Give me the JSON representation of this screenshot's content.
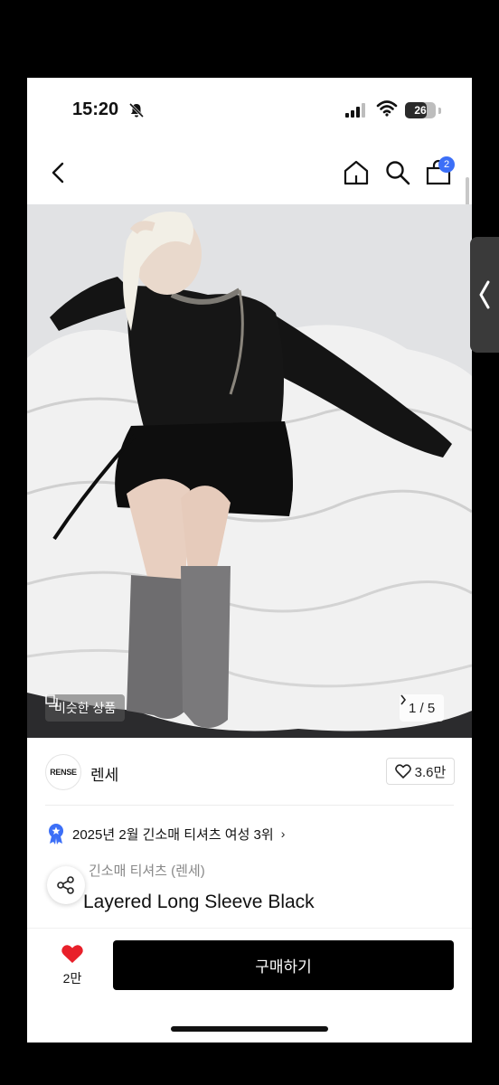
{
  "status_bar": {
    "time": "15:20",
    "battery": "26",
    "icons": [
      "bell-muted-icon",
      "signal-icon",
      "wifi-icon",
      "battery-icon"
    ]
  },
  "header": {
    "icons": [
      "back-arrow-icon",
      "home-icon",
      "search-icon",
      "cart-icon"
    ],
    "cart_badge": "2"
  },
  "hero": {
    "similar_label": "비슷한 상품",
    "page_counter": "1 / 5",
    "page_fraction": 0.2
  },
  "brand": {
    "logo_text": "RENSE",
    "name": "렌세",
    "like_count": "3.6만"
  },
  "ranking": {
    "text": "2025년 2월 긴소매 티셔츠 여성 3위",
    "arrow": "›"
  },
  "product": {
    "category_visible": "긴소매 티셔츠 (렌세)",
    "name_visible": "Layered Long Sleeve Black"
  },
  "bottom_bar": {
    "wish_count": "2만",
    "buy_label": "구매하기"
  },
  "colors": {
    "accent_blue": "#3c6ff7",
    "heart_red": "#e8202a",
    "buy_button": "#000000"
  }
}
